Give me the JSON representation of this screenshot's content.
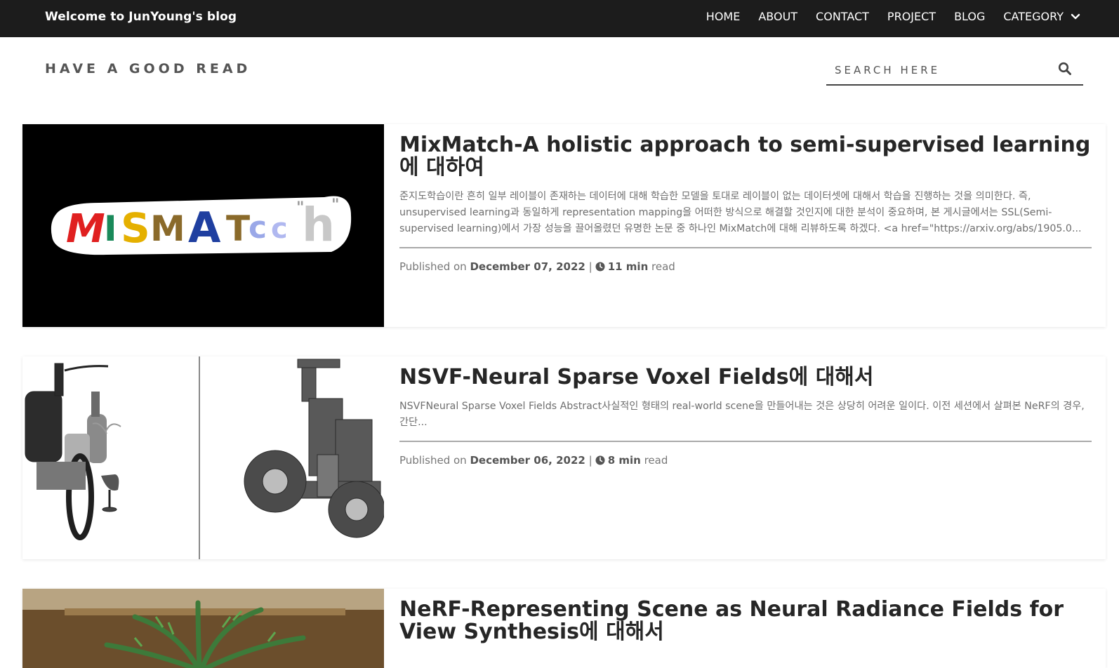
{
  "header": {
    "brand": "Welcome to JunYoung's blog",
    "nav": [
      "HOME",
      "ABOUT",
      "CONTACT",
      "PROJECT",
      "BLOG",
      "CATEGORY"
    ]
  },
  "subheader": {
    "tagline": "HAVE A GOOD READ",
    "search_placeholder": "SEARCH HERE"
  },
  "posts": [
    {
      "title": "MixMatch-A holistic approach to semi-supervised learning에 대하여",
      "excerpt": "준지도학습이란 흔히 일부 레이블이 존재하는 데이터에 대해 학습한 모델을 토대로 레이블이 없는 데이터셋에 대해서 학습을 진행하는 것을 의미한다. 즉, unsupervised learning과 동일하게 representation mapping을 어떠한 방식으로 해결할 것인지에 대한 분석이 중요하며, 본 게시글에서는 SSL(Semi-supervised learning)에서 가장 성능을 끌어올렸던 유명한 논문 중 하나인 MixMatch에 대해 리뷰하도록 하겠다. <a href=\"https://arxiv.org/abs/1905.0...",
      "published_label": "Published on",
      "date": "December 07, 2022",
      "sep": "|",
      "read_time": "11 min",
      "read_label": "read",
      "thumb_text": "MISMATch"
    },
    {
      "title": "NSVF-Neural Sparse Voxel Fields에 대해서",
      "excerpt": "NSVFNeural Sparse Voxel Fields Abstract사실적인 형태의 real-world scene을 만들어내는 것은 상당히 어려운 일이다. 이전 세션에서 살펴본 NeRF의 경우, 간단...",
      "published_label": "Published on",
      "date": "December 06, 2022",
      "sep": "|",
      "read_time": "8 min",
      "read_label": "read"
    },
    {
      "title": "NeRF-Representing Scene as Neural Radiance Fields for View Synthesis에 대해서"
    }
  ]
}
